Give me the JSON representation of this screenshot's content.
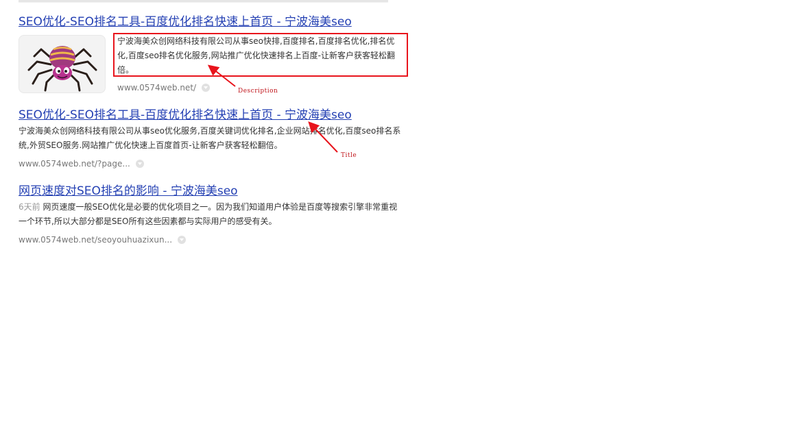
{
  "results": [
    {
      "title": "SEO优化-SEO排名工具-百度优化排名快速上首页 - 宁波海美seo",
      "description": "宁波海美众创网络科技有限公司从事seo快排,百度排名,百度排名优化,排名优化,百度seo排名优化服务,网站推广优化快速排名上百度-让新客户获客轻松翻倍。",
      "url": "www.0574web.net/"
    },
    {
      "title": "SEO优化-SEO排名工具-百度优化排名快速上首页 - 宁波海美seo",
      "description": "宁波海美众创网络科技有限公司从事seo优化服务,百度关键词优化排名,企业网站排名优化,百度seo排名系统,外贸SEO服务.网站推广优化快速上百度首页-让新客户获客轻松翻倍。",
      "url": "www.0574web.net/?page..."
    },
    {
      "title": "网页速度对SEO排名的影响 - 宁波海美seo",
      "date": "6天前",
      "description": "网页速度一般SEO优化是必要的优化项目之一。因为我们知道用户体验是百度等搜索引擎非常重视一个环节,所以大部分都是SEO所有这些因素都与实际用户的感受有关。",
      "url": "www.0574web.net/seoyouhuazixun..."
    }
  ],
  "annotations": {
    "description_label": "Description",
    "title_label": "Title"
  },
  "colors": {
    "link": "#2440b3",
    "annotation": "#e8141c",
    "text": "#333333",
    "url": "#777777"
  },
  "icons": [
    "spider-mascot-icon",
    "dropdown-icon"
  ]
}
